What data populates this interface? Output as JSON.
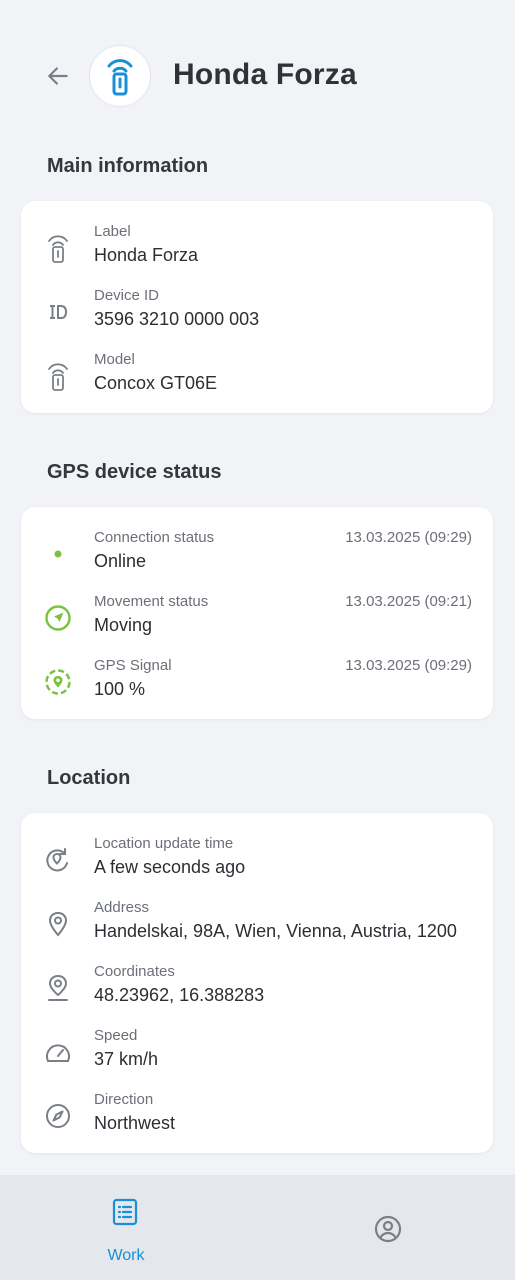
{
  "header": {
    "title": "Honda Forza"
  },
  "sections": {
    "main": {
      "title": "Main information",
      "rows": [
        {
          "label": "Label",
          "value": "Honda Forza",
          "icon": "gps-tracker-icon"
        },
        {
          "label": "Device ID",
          "value": "3596 3210 0000 003",
          "icon": "id-icon"
        },
        {
          "label": "Model",
          "value": "Concox GT06E",
          "icon": "gps-tracker-icon"
        }
      ]
    },
    "status": {
      "title": "GPS device status",
      "rows": [
        {
          "label": "Connection status",
          "value": "Online",
          "time": "13.03.2025 (09:29)",
          "icon": "online-dot-icon"
        },
        {
          "label": "Movement status",
          "value": "Moving",
          "time": "13.03.2025 (09:21)",
          "icon": "navigation-arrow-icon"
        },
        {
          "label": "GPS Signal",
          "value": "100 %",
          "time": "13.03.2025 (09:29)",
          "icon": "gps-signal-icon"
        }
      ]
    },
    "location": {
      "title": "Location",
      "rows": [
        {
          "label": "Location update time",
          "value": "A few seconds ago",
          "icon": "location-refresh-icon"
        },
        {
          "label": "Address",
          "value": "Handelskai, 98A, Wien, Vienna, Austria, 1200",
          "icon": "map-pin-icon"
        },
        {
          "label": "Coordinates",
          "value": "48.23962, 16.388283",
          "icon": "coordinates-pin-icon"
        },
        {
          "label": "Speed",
          "value": "37 km/h",
          "icon": "speedometer-icon"
        },
        {
          "label": "Direction",
          "value": "Northwest",
          "icon": "compass-icon"
        }
      ]
    }
  },
  "bottom_nav": {
    "work_label": "Work"
  },
  "colors": {
    "accent": "#1a8fd6",
    "status_green": "#7cc242",
    "icon_gray": "#7a7f87"
  }
}
